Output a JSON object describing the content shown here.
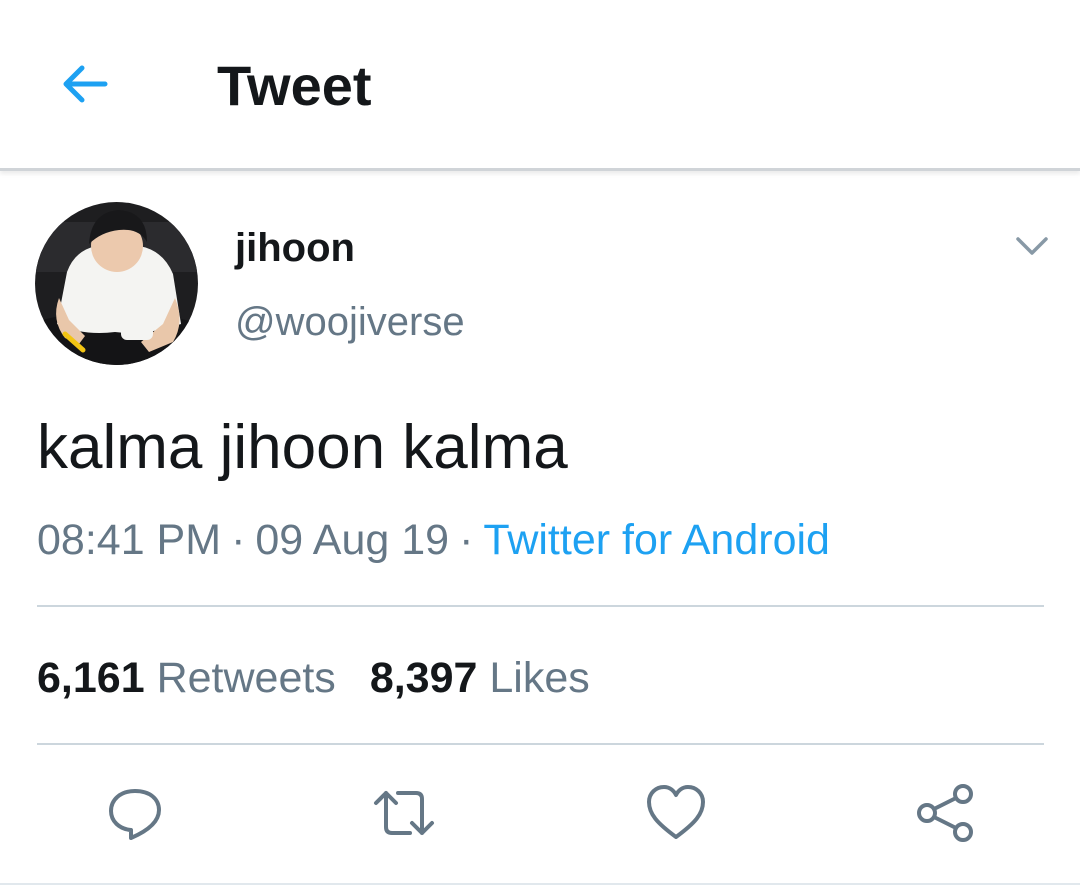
{
  "header": {
    "title": "Tweet",
    "back_icon": "arrow-left-icon"
  },
  "colors": {
    "accent": "#1da1f2",
    "secondary_text": "#657786",
    "primary_text": "#14171a",
    "divider": "#ccd6dd"
  },
  "author": {
    "display_name": "jihoon",
    "handle": "@woojiverse",
    "menu_icon": "chevron-down-icon"
  },
  "tweet": {
    "text": "kalma jihoon kalma",
    "time": "08:41 PM",
    "date": "09 Aug 19",
    "separator": "·",
    "source": "Twitter for Android"
  },
  "stats": {
    "retweets_count": "6,161",
    "retweets_label": "Retweets",
    "likes_count": "8,397",
    "likes_label": "Likes"
  },
  "actions": [
    {
      "icon": "reply-icon"
    },
    {
      "icon": "retweet-icon"
    },
    {
      "icon": "like-heart-icon"
    },
    {
      "icon": "share-icon"
    }
  ]
}
